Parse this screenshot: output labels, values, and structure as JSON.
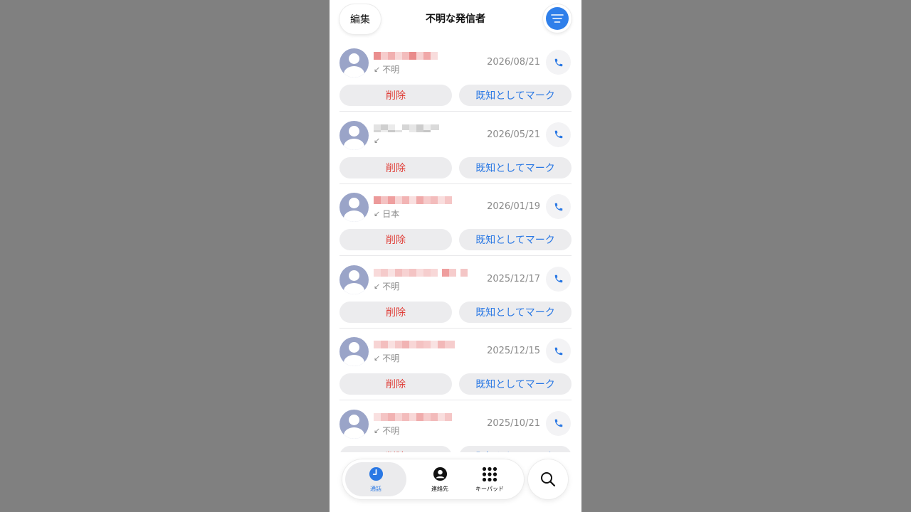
{
  "header": {
    "edit_label": "編集",
    "title": "不明な発信者",
    "filter_icon": "filter-lines-icon"
  },
  "colors": {
    "accent": "#2a78e4",
    "destructive": "#e0403a",
    "secondary_text": "#8a8a8a",
    "avatar": "#9aa4c8"
  },
  "entries": [
    {
      "name": "[redacted]",
      "location": "不明",
      "date": "2026/08/21"
    },
    {
      "name": "[redacted]",
      "location": "",
      "date": "2026/05/21"
    },
    {
      "name": "[redacted]",
      "location": "日本",
      "date": "2026/01/19"
    },
    {
      "name": "[redacted]",
      "location": "不明",
      "date": "2025/12/17"
    },
    {
      "name": "[redacted]",
      "location": "不明",
      "date": "2025/12/15"
    },
    {
      "name": "[redacted]",
      "location": "不明",
      "date": "2025/10/21"
    }
  ],
  "actions": {
    "delete_label": "削除",
    "mark_known_label": "既知としてマーク"
  },
  "tabbar": {
    "tabs": [
      {
        "label": "通話",
        "icon": "clock-icon",
        "active": true
      },
      {
        "label": "連絡先",
        "icon": "person-icon",
        "active": false
      },
      {
        "label": "キーパッド",
        "icon": "keypad-icon",
        "active": false
      }
    ],
    "search_icon": "search-icon"
  }
}
